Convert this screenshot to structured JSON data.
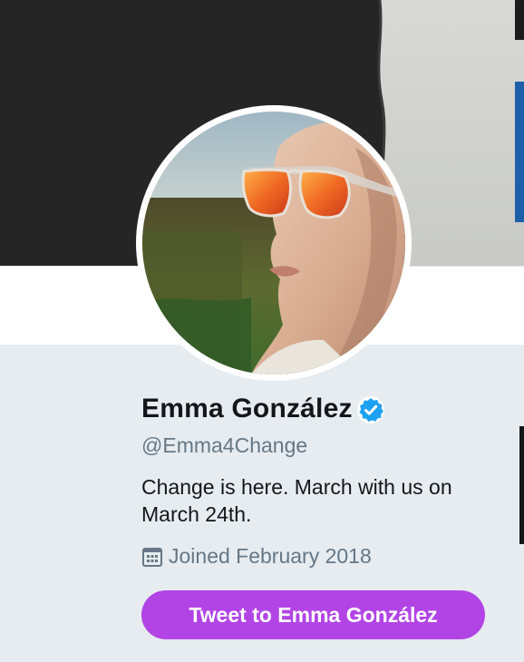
{
  "profile": {
    "display_name": "Emma González",
    "verified": true,
    "screen_name": "@Emma4Change",
    "bio": "Change is here. March with us on March 24th.",
    "joined": "Joined February 2018",
    "tweet_button_label": "Tweet to Emma González"
  },
  "icons": {
    "verified": "verified-badge-icon",
    "joined": "calendar-icon"
  },
  "colors": {
    "banner_dark": "#252525",
    "profile_bg": "#e6ecf0",
    "name_text": "#14171a",
    "secondary_text": "#657786",
    "accent_button": "#b244e6",
    "verified_blue": "#1da1f2"
  }
}
